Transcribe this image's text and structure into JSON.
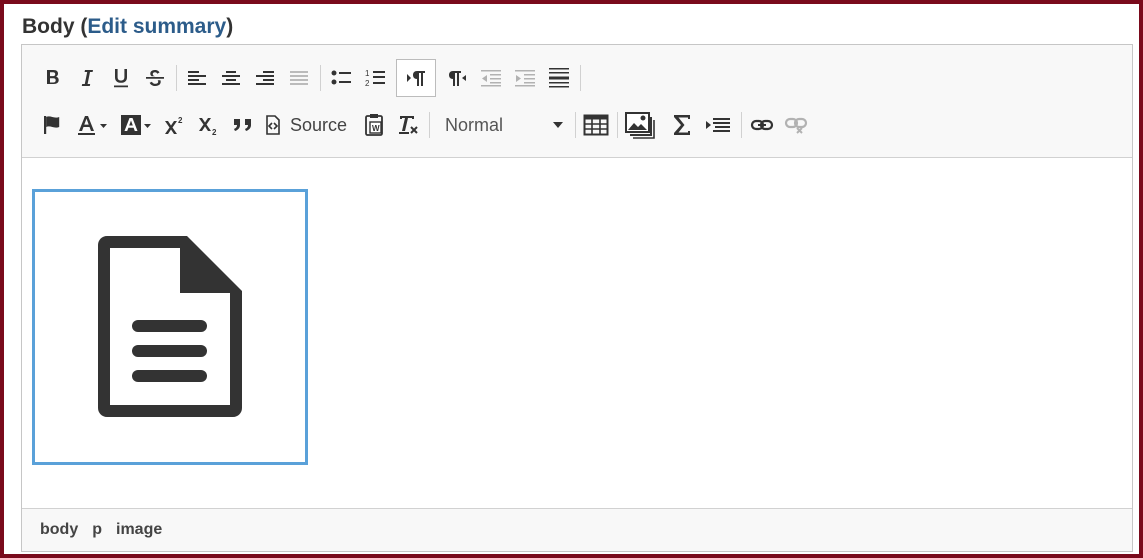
{
  "field": {
    "label": "Body",
    "link_label": "Edit summary"
  },
  "toolbar": {
    "row1": [
      {
        "icon": "bold-icon",
        "label": "B"
      },
      {
        "icon": "italic-icon",
        "label": "I"
      },
      {
        "icon": "underline-icon",
        "label": "U"
      },
      {
        "icon": "strikethrough-icon",
        "label": "S"
      },
      {
        "icon": "align-left-icon"
      },
      {
        "icon": "align-center-icon"
      },
      {
        "icon": "align-right-icon"
      },
      {
        "icon": "align-justify-icon"
      },
      {
        "icon": "bulleted-list-icon"
      },
      {
        "icon": "numbered-list-icon"
      },
      {
        "icon": "ltr-paragraph-icon",
        "active": true
      },
      {
        "icon": "rtl-paragraph-icon"
      },
      {
        "icon": "outdent-icon",
        "disabled": true
      },
      {
        "icon": "indent-icon",
        "disabled": true
      },
      {
        "icon": "horizontal-rule-icon"
      }
    ],
    "source_label": "Source",
    "format_select": {
      "selected": "Normal"
    },
    "icons_row2": [
      "flag-icon",
      "text-color-icon",
      "background-color-icon",
      "superscript-icon",
      "subscript-icon",
      "blockquote-icon",
      "source-icon",
      "paste-from-word-icon",
      "remove-format-icon",
      "table-icon",
      "image-icon",
      "math-icon",
      "template-icon",
      "link-icon",
      "unlink-icon"
    ]
  },
  "content": {
    "image_icon": "document-icon"
  },
  "statusbar": {
    "path": [
      "body",
      "p",
      "image"
    ]
  },
  "colors": {
    "frame_border": "#7a0a1c",
    "link": "#2c5c8a",
    "selection": "#5aa1d9",
    "toolbar_bg": "#f8f8f8"
  }
}
